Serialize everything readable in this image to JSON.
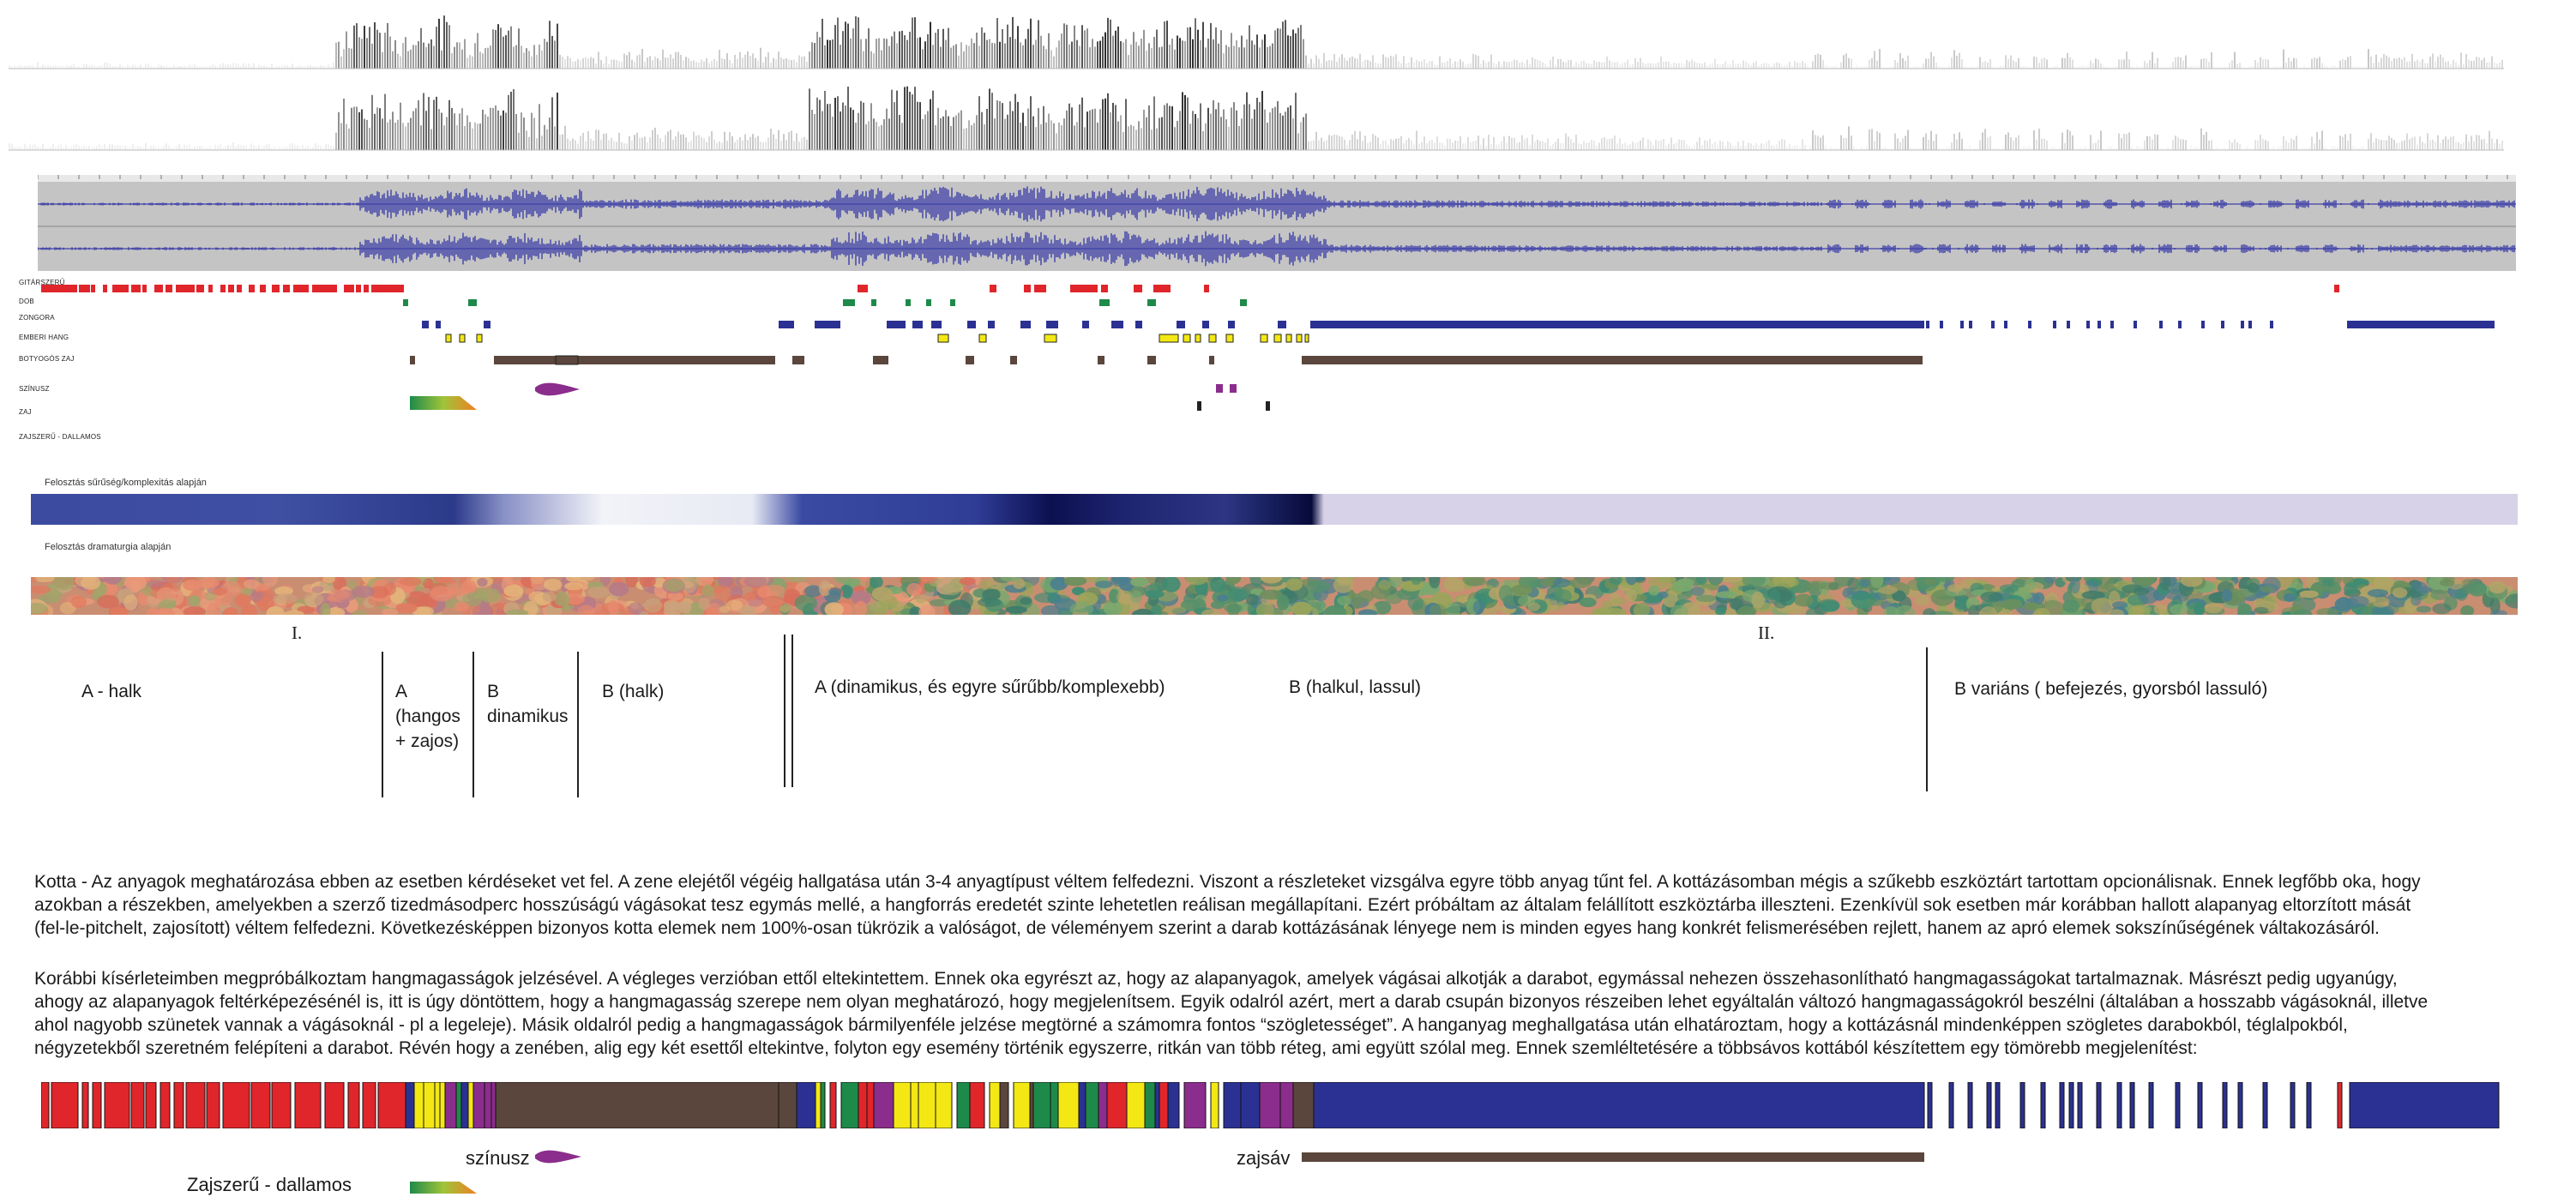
{
  "colors": {
    "gitarszeru": "#e0262b",
    "dob": "#1e8a4a",
    "zongora": "#2b3192",
    "emberi_hang": "#f3e814",
    "botyogos_zaj": "#5a463c",
    "szinusz": "#8b2d8c",
    "zaj": "#222222",
    "waveform_bg": "#c4c4c4",
    "waveform": "#3d3fa8"
  },
  "tracks": {
    "labels": [
      "GITÁRSZERŰ",
      "DOB",
      "ZONGORA",
      "EMBERI HANG",
      "BOTYOGÓS ZAJ",
      "SZÍNUSZ",
      "ZAJ",
      "ZAJSZERŰ - DALLAMOS"
    ]
  },
  "bands": {
    "density_label": "Felosztás sűrűség/komplexitás alapján",
    "drama_label": "Felosztás dramaturgia alapján"
  },
  "parts": {
    "part1": "I.",
    "part2": "II."
  },
  "sections": {
    "s1": "A - halk",
    "s2_l1": "A",
    "s2_l2": "(hangos",
    "s2_l3": "+ zajos)",
    "s3_l1": "B",
    "s3_l2": "dinamikus",
    "s4": "B  (halk)",
    "s5": "A (dinamikus, és egyre sűrűbb/komplexebb)",
    "s6": "B (halkul, lassul)",
    "s7": "B variáns ( befejezés, gyorsból lassuló)"
  },
  "paragraphs": {
    "p1_l1": "Kotta - Az anyagok meghatározása ebben az esetben kérdéseket vet fel. A zene elejétől végéig hallgatása után 3-4 anyagtípust véltem felfedezni. Viszont a részleteket vizsgálva egyre több anyag tűnt fel. A kottázásomban mégis a szűkebb eszköztárt tartottam opcionálisnak. Ennek legfőbb oka, hogy",
    "p1_l2": " azokban a részekben, amelyekben a szerző tizedmásodperc hosszúságú vágásokat tesz egymás mellé, a hangforrás eredetét szinte lehetetlen reálisan megállapítani. Ezért próbáltam az általam felállított eszköztárba illeszteni. Ezenkívül sok esetben már korábban hallott alapanyag eltorzított mását",
    "p1_l3": "(fel-le-pitchelt, zajosított) véltem felfedezni. Következésképpen bizonyos kotta elemek nem 100%-osan tükrözik a valóságot, de véleményem szerint a darab kottázásának lényege nem is minden egyes hang konkrét felismerésében rejlett, hanem az apró elemek sokszínűségének váltakozásáról.",
    "p2_l1": "Korábbi kísérleteimben megpróbálkoztam hangmagasságok jelzésével. A végleges verzióban ettől eltekintettem. Ennek oka egyrészt az, hogy az alapanyagok, amelyek vágásai alkotják a darabot, egymással nehezen összehasonlítható hangmagasságokat tartalmaznak. Másrészt pedig ugyanúgy,",
    "p2_l2": "ahogy az alapanyagok feltérképezésénél is, itt is úgy döntöttem, hogy a hangmagasság szerepe nem olyan meghatározó, hogy megjelenítsem. Egyik odalról azért, mert a darab csupán bizonyos részeiben lehet egyáltalán változó hangmagasságokról beszélni (általában a hosszabb vágásoknál, illetve",
    "p2_l3": "ahol nagyobb szünetek vannak a vágásoknál - pl a legeleje). Másik oldalról pedig a hangmagasságok bármilyenféle jelzése megtörné a számomra fontos “szögletességet”.  A hanganyag meghallgatása után elhatároztam, hogy a kottázásnál mindenképpen szögletes darabokból, téglalpokból,",
    "p2_l4": "négyzetekből szeretném felépíteni a darabot. Révén hogy a zenében, alig egy két esettől eltekintve, folyton egy esemény történik egyszerre, ritkán van több réteg, ami együtt szólal meg. Ennek szemléltetésére a többsávos kottából készítettem egy tömörebb megjelenítést:"
  },
  "legend": {
    "szinusz": "színusz",
    "zajsav": "zajsáv",
    "zajszeru_dallamos": "Zajszerű - dallamos"
  }
}
